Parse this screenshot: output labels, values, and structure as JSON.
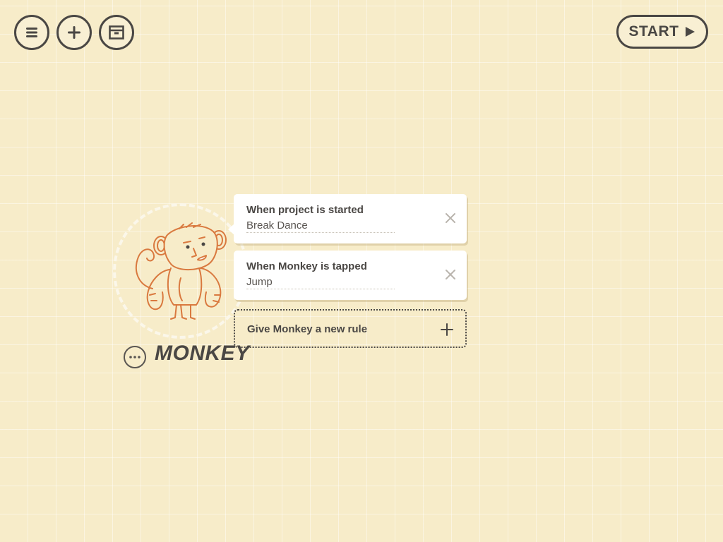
{
  "toolbar": {
    "menu_icon": "menu-icon",
    "add_icon": "plus-icon",
    "box_icon": "inventory-box-icon",
    "start_label": "START",
    "start_icon": "play-icon"
  },
  "character": {
    "name": "MONKEY",
    "icon": "monkey-icon",
    "options_icon": "more-options-icon",
    "outline_color": "#d9793f"
  },
  "rules": [
    {
      "trigger": "When project is started",
      "action": "Break Dance",
      "close_icon": "close-icon"
    },
    {
      "trigger": "When Monkey is tapped",
      "action": "Jump",
      "close_icon": "close-icon"
    }
  ],
  "new_rule": {
    "label": "Give Monkey a new rule",
    "icon": "plus-icon"
  },
  "colors": {
    "background": "#f7ecc9",
    "ink": "#4a4744",
    "card": "#ffffff"
  }
}
